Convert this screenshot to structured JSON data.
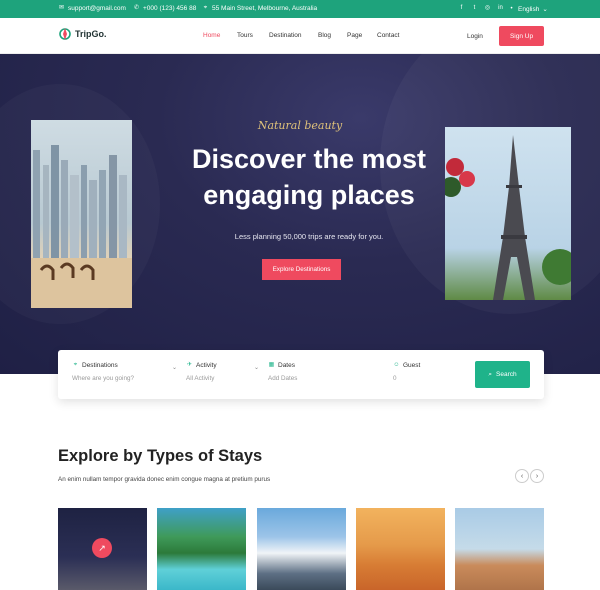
{
  "topbar": {
    "email": "support@gmail.com",
    "phone": "+000 (123) 456 88",
    "address": "55 Main Street, Melbourne, Australia",
    "language": "English"
  },
  "brand": {
    "name": "TripGo."
  },
  "nav": {
    "items": [
      "Home",
      "Tours",
      "Destination",
      "Blog",
      "Page",
      "Contact"
    ],
    "active": "Home",
    "login": "Login",
    "signup": "Sign Up"
  },
  "hero": {
    "script": "Natural beauty",
    "title": "Discover the most engaging places",
    "subtitle": "Less planning 50,000 trips are ready for you.",
    "cta": "Explore Destinations"
  },
  "search": {
    "fields": [
      {
        "label": "Destinations",
        "value": "Where are you going?",
        "icon": "map-pin-icon"
      },
      {
        "label": "Activity",
        "value": "All Activity",
        "icon": "plane-icon"
      },
      {
        "label": "Dates",
        "value": "Add Dates",
        "icon": "calendar-icon"
      },
      {
        "label": "Guest",
        "value": "0",
        "icon": "user-icon"
      }
    ],
    "button": "Search"
  },
  "stays": {
    "title": "Explore by Types of Stays",
    "subtitle": "An enim nullam tempor gravida donec enim congue magna at pretium purus"
  },
  "colors": {
    "accent": "#ef4a5f",
    "brand_green": "#1ea37c",
    "search_green": "#1fb38a"
  }
}
